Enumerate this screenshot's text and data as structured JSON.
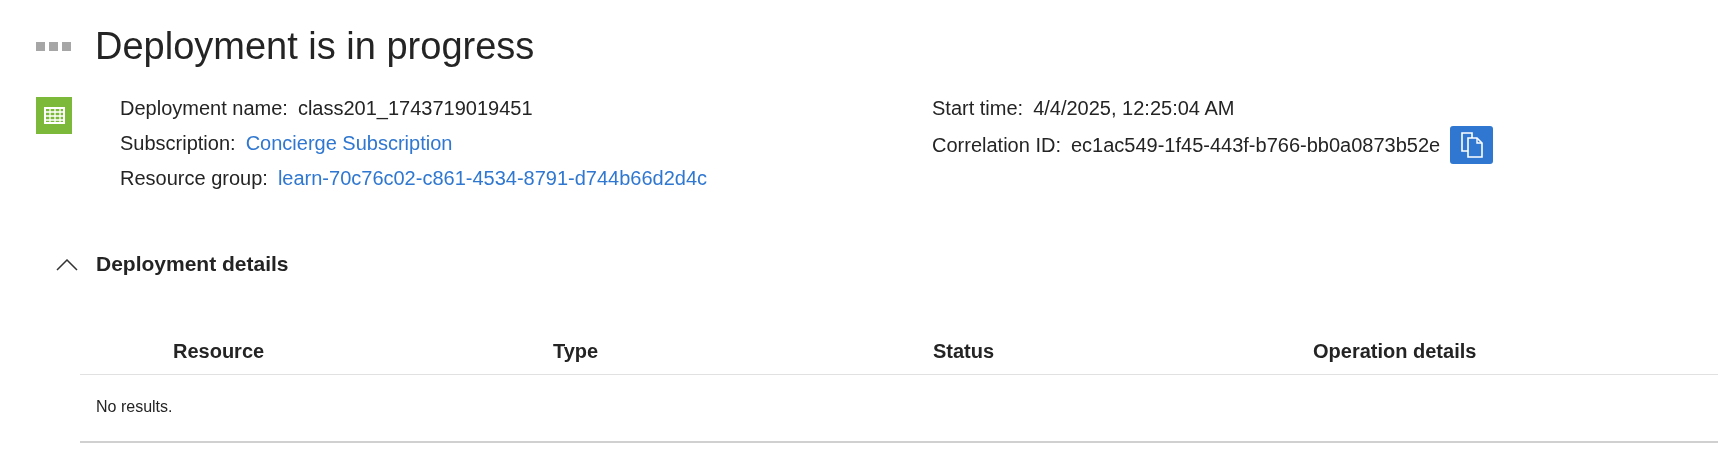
{
  "title": "Deployment is in progress",
  "summary_left": [
    {
      "label": "Deployment name:",
      "value": "class201_1743719019451",
      "kind": "text"
    },
    {
      "label": "Subscription:",
      "value": "Concierge Subscription",
      "kind": "link"
    },
    {
      "label": "Resource group:",
      "value": "learn-70c76c02-c861-4534-8791-d744b66d2d4c",
      "kind": "link"
    }
  ],
  "summary_right": [
    {
      "label": "Start time:",
      "value": "4/4/2025, 12:25:04 AM",
      "kind": "text"
    },
    {
      "label": "Correlation ID:",
      "value": "ec1ac549-1f45-443f-b766-bb0a0873b52e",
      "kind": "copy"
    }
  ],
  "details": {
    "title": "Deployment details",
    "expanded": true,
    "table": {
      "columns": [
        "Resource",
        "Type",
        "Status",
        "Operation details"
      ],
      "empty_message": "No results."
    }
  }
}
